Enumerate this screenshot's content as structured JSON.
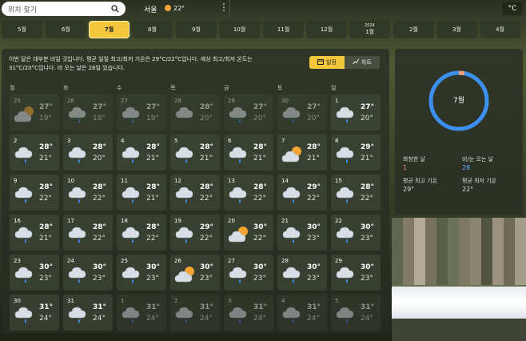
{
  "search": {
    "placeholder": "위치 찾기"
  },
  "location": {
    "city": "서울",
    "temp": "22°"
  },
  "unit": "°C",
  "months": [
    {
      "label": "5월",
      "year": ""
    },
    {
      "label": "6월",
      "year": ""
    },
    {
      "label": "7월",
      "year": "",
      "active": true
    },
    {
      "label": "8월",
      "year": ""
    },
    {
      "label": "9월",
      "year": ""
    },
    {
      "label": "10월",
      "year": ""
    },
    {
      "label": "11월",
      "year": ""
    },
    {
      "label": "12월",
      "year": ""
    },
    {
      "label": "1월",
      "year": "2024"
    },
    {
      "label": "2월",
      "year": ""
    },
    {
      "label": "3월",
      "year": ""
    },
    {
      "label": "4월",
      "year": ""
    }
  ],
  "summary": "이번 달은 대부분 비일 것입니다. 평균 일일 최고/최저 기온은 29°C/22°C입니다. 예상 최고/최저 온도는 31°C/20°C입니다. 비 오는 날은 28일 있습니다.",
  "view": {
    "calendar": "일정",
    "chart": "차트"
  },
  "weekdays": [
    "월",
    "화",
    "수",
    "목",
    "금",
    "토",
    "일"
  ],
  "days": [
    {
      "d": "25",
      "hi": "27°",
      "lo": "19°",
      "icon": "partly-cloudy-icon",
      "dim": true
    },
    {
      "d": "26",
      "hi": "27°",
      "lo": "19°",
      "icon": "rain-icon",
      "dim": true
    },
    {
      "d": "27",
      "hi": "27°",
      "lo": "19°",
      "icon": "rain-icon",
      "dim": true
    },
    {
      "d": "28",
      "hi": "28°",
      "lo": "20°",
      "icon": "cloudy-icon",
      "dim": true
    },
    {
      "d": "29",
      "hi": "27°",
      "lo": "20°",
      "icon": "rain-icon",
      "dim": true
    },
    {
      "d": "30",
      "hi": "27°",
      "lo": "20°",
      "icon": "rain-icon",
      "dim": true
    },
    {
      "d": "1",
      "hi": "27°",
      "lo": "20°",
      "icon": "rain-icon"
    },
    {
      "d": "2",
      "hi": "28°",
      "lo": "21°",
      "icon": "rain-icon"
    },
    {
      "d": "3",
      "hi": "28°",
      "lo": "20°",
      "icon": "rain-icon"
    },
    {
      "d": "4",
      "hi": "28°",
      "lo": "21°",
      "icon": "rain-icon"
    },
    {
      "d": "5",
      "hi": "28°",
      "lo": "21°",
      "icon": "rain-icon"
    },
    {
      "d": "6",
      "hi": "28°",
      "lo": "21°",
      "icon": "rain-icon"
    },
    {
      "d": "7",
      "hi": "28°",
      "lo": "21°",
      "icon": "partly-cloudy-icon"
    },
    {
      "d": "8",
      "hi": "29°",
      "lo": "21°",
      "icon": "rain-icon"
    },
    {
      "d": "9",
      "hi": "28°",
      "lo": "22°",
      "icon": "rain-icon"
    },
    {
      "d": "10",
      "hi": "28°",
      "lo": "22°",
      "icon": "rain-icon"
    },
    {
      "d": "11",
      "hi": "28°",
      "lo": "21°",
      "icon": "rain-icon"
    },
    {
      "d": "12",
      "hi": "28°",
      "lo": "22°",
      "icon": "rain-icon"
    },
    {
      "d": "13",
      "hi": "28°",
      "lo": "22°",
      "icon": "rain-icon"
    },
    {
      "d": "14",
      "hi": "29°",
      "lo": "22°",
      "icon": "rain-icon"
    },
    {
      "d": "15",
      "hi": "28°",
      "lo": "22°",
      "icon": "rain-icon"
    },
    {
      "d": "16",
      "hi": "28°",
      "lo": "21°",
      "icon": "rain-icon"
    },
    {
      "d": "17",
      "hi": "28°",
      "lo": "22°",
      "icon": "rain-icon"
    },
    {
      "d": "18",
      "hi": "28°",
      "lo": "22°",
      "icon": "rain-icon"
    },
    {
      "d": "19",
      "hi": "29°",
      "lo": "22°",
      "icon": "rain-icon"
    },
    {
      "d": "20",
      "hi": "30°",
      "lo": "22°",
      "icon": "partly-cloudy-icon"
    },
    {
      "d": "21",
      "hi": "30°",
      "lo": "23°",
      "icon": "rain-icon"
    },
    {
      "d": "22",
      "hi": "30°",
      "lo": "23°",
      "icon": "rain-icon"
    },
    {
      "d": "23",
      "hi": "30°",
      "lo": "23°",
      "icon": "rain-icon"
    },
    {
      "d": "24",
      "hi": "30°",
      "lo": "23°",
      "icon": "rain-icon"
    },
    {
      "d": "25",
      "hi": "30°",
      "lo": "23°",
      "icon": "rain-icon"
    },
    {
      "d": "26",
      "hi": "30°",
      "lo": "23°",
      "icon": "partly-cloudy-icon"
    },
    {
      "d": "27",
      "hi": "30°",
      "lo": "23°",
      "icon": "rain-icon"
    },
    {
      "d": "28",
      "hi": "30°",
      "lo": "23°",
      "icon": "rain-icon"
    },
    {
      "d": "29",
      "hi": "30°",
      "lo": "23°",
      "icon": "rain-icon"
    },
    {
      "d": "30",
      "hi": "31°",
      "lo": "24°",
      "icon": "rain-icon"
    },
    {
      "d": "31",
      "hi": "31°",
      "lo": "24°",
      "icon": "rain-icon"
    },
    {
      "d": "1",
      "hi": "31°",
      "lo": "24°",
      "icon": "rain-icon",
      "dim": true
    },
    {
      "d": "2",
      "hi": "31°",
      "lo": "24°",
      "icon": "rain-icon",
      "dim": true
    },
    {
      "d": "3",
      "hi": "31°",
      "lo": "24°",
      "icon": "rain-icon",
      "dim": true
    },
    {
      "d": "4",
      "hi": "31°",
      "lo": "24°",
      "icon": "rain-icon",
      "dim": true
    },
    {
      "d": "5",
      "hi": "31°",
      "lo": "24°",
      "icon": "rain-icon",
      "dim": true
    }
  ],
  "sidebar": {
    "month": "7월",
    "ring_fraction": 0.03,
    "stats": [
      {
        "label": "화창한 날",
        "value": "1",
        "color": "#f08a8a"
      },
      {
        "label": "비/눈 오는 날",
        "value": "28",
        "color": "#6fb6ff"
      },
      {
        "label": "평균 최고 기온",
        "value": "29°",
        "color": "#ffffff"
      },
      {
        "label": "평균 최저 기온",
        "value": "22°",
        "color": "#ffffff"
      }
    ]
  },
  "colors": {
    "accent": "#f3c73c",
    "ring": "#3d8ff0",
    "sun": "#f4a532"
  }
}
